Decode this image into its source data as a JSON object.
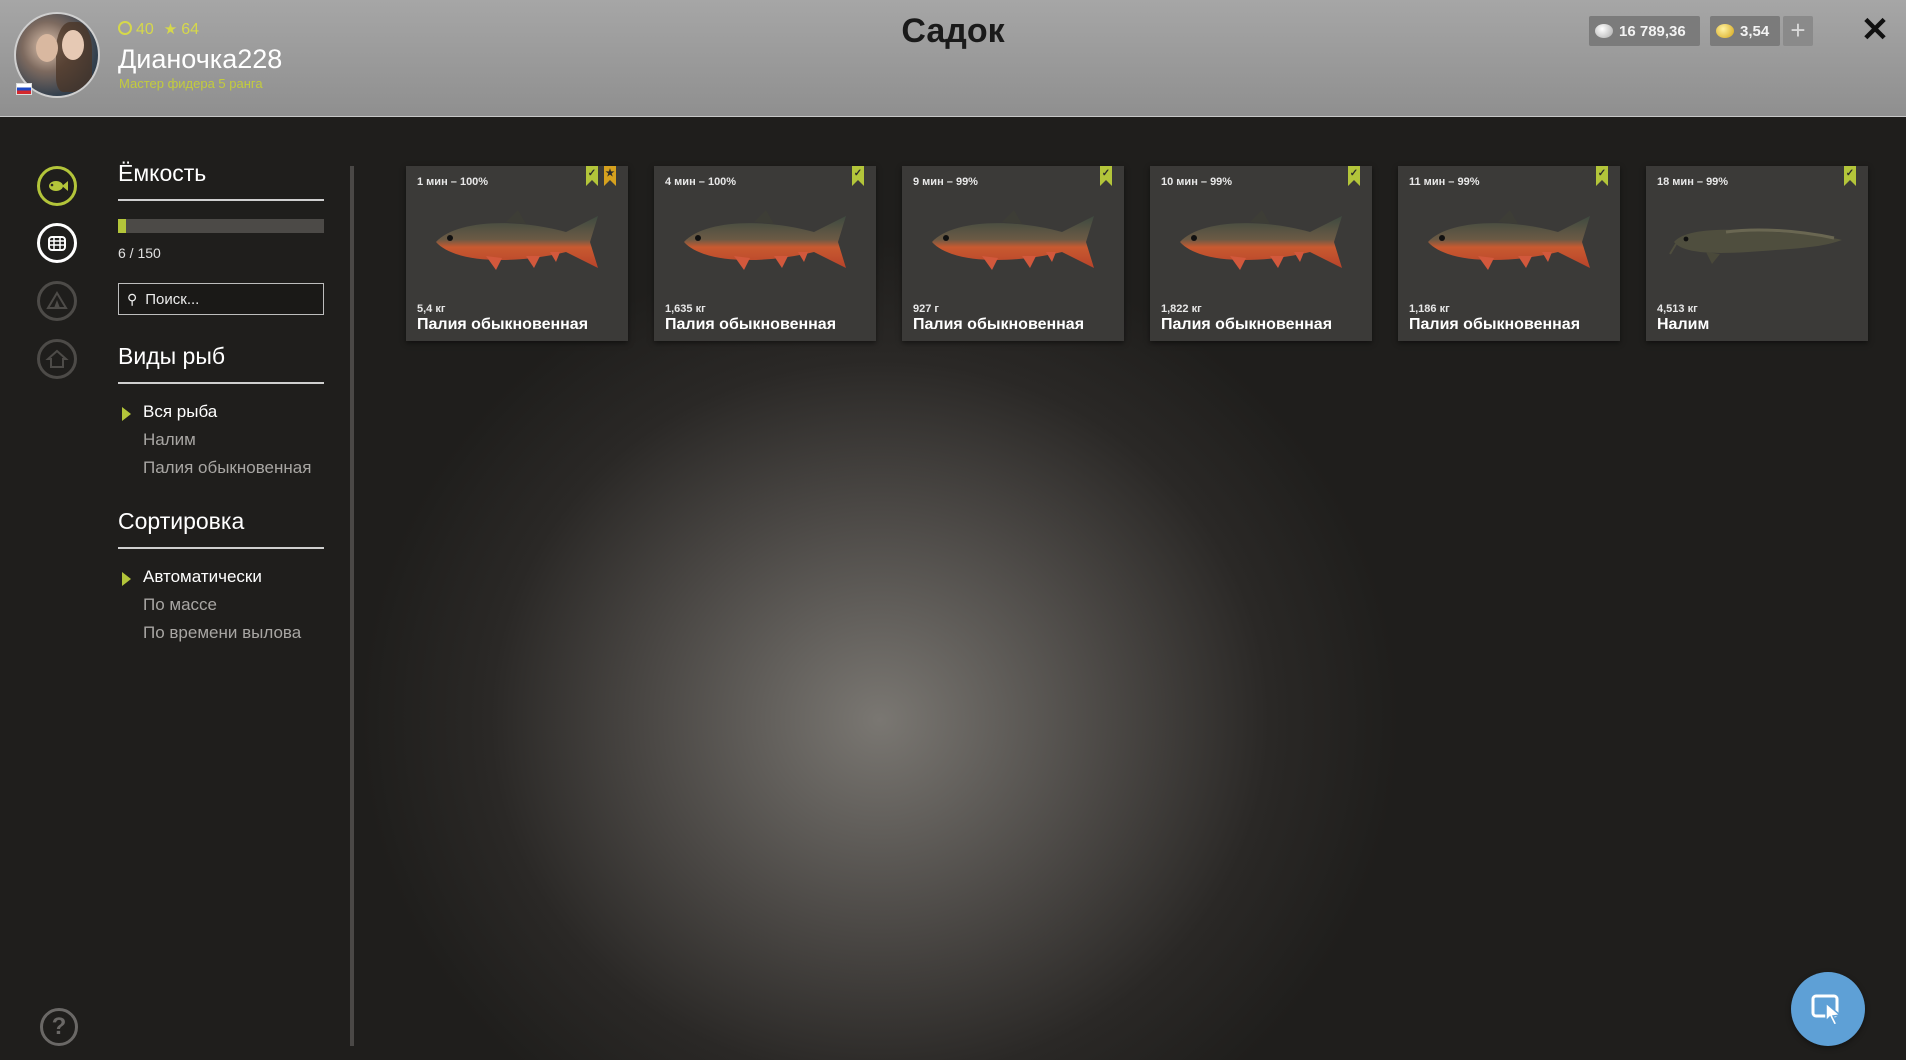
{
  "header": {
    "title": "Садок",
    "player": {
      "level": "40",
      "stars": "64",
      "username": "Дианочка228",
      "rank": "Мастер фидера 5 ранга"
    },
    "currency": {
      "silver": "16 789,36",
      "gold": "3,54"
    },
    "plus_label": "+",
    "close_label": "✕"
  },
  "rail": {
    "icons": [
      "fish-keepnet-icon",
      "keepnet-net-icon",
      "camp-tent-icon",
      "home-icon"
    ],
    "help_label": "?"
  },
  "panel": {
    "capacity_title": "Ёмкость",
    "capacity_text": "6 / 150",
    "capacity_fraction": 0.04,
    "search_placeholder": "Поиск...",
    "species_title": "Виды рыб",
    "species": [
      "Вся рыба",
      "Налим",
      "Палия обыкновенная"
    ],
    "species_active": 0,
    "sort_title": "Сортировка",
    "sort": [
      "Автоматически",
      "По массе",
      "По времени вылова"
    ],
    "sort_active": 0
  },
  "cards": [
    {
      "time": "1 мин – 100%",
      "weight": "5,4 кг",
      "name": "Палия обыкновенная",
      "bookmarks": [
        "green",
        "gold"
      ]
    },
    {
      "time": "4 мин – 100%",
      "weight": "1,635 кг",
      "name": "Палия обыкновенная",
      "bookmarks": [
        "green"
      ]
    },
    {
      "time": "9 мин – 99%",
      "weight": "927 г",
      "name": "Палия обыкновенная",
      "bookmarks": [
        "green"
      ]
    },
    {
      "time": "10 мин – 99%",
      "weight": "1,822 кг",
      "name": "Палия обыкновенная",
      "bookmarks": [
        "green"
      ]
    },
    {
      "time": "11 мин – 99%",
      "weight": "1,186 кг",
      "name": "Палия обыкновенная",
      "bookmarks": [
        "green"
      ]
    },
    {
      "time": "18 мин – 99%",
      "weight": "4,513 кг",
      "name": "Налим",
      "bookmarks": [
        "green"
      ]
    }
  ],
  "colors": {
    "accent_green": "#b3c53a",
    "bookmark_gold": "#d6a11e",
    "action_blue": "#5ea0d6"
  }
}
